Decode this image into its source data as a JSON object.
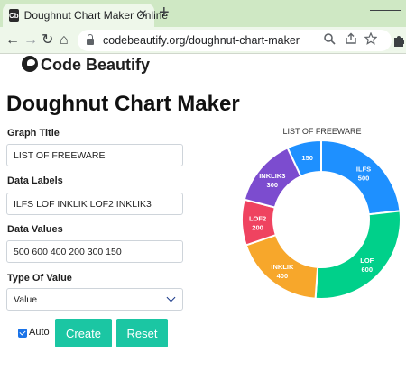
{
  "browser": {
    "tab_title": "Doughnut Chart Maker Online",
    "favicon_text": "Cb",
    "url": "codebeautify.org/doughnut-chart-maker",
    "new_tab": "+",
    "close": "×",
    "back": "←",
    "forward": "→",
    "reload": "↻",
    "home": "⌂"
  },
  "site": {
    "logo_text": "Code Beautify"
  },
  "page": {
    "title": "Doughnut Chart Maker",
    "graph_title_label": "Graph Title",
    "graph_title_value": "LIST OF FREEWARE",
    "data_labels_label": "Data Labels",
    "data_labels_value": "ILFS LOF INKLIK LOF2 INKLIK3",
    "data_values_label": "Data Values",
    "data_values_value": "500 600 400 200 300 150",
    "type_label": "Type Of Value",
    "type_value": "Value",
    "auto_label": "Auto",
    "create_label": "Create",
    "reset_label": "Reset"
  },
  "chart_data": {
    "type": "pie",
    "title": "LIST OF FREEWARE",
    "categories": [
      "ILFS",
      "LOF",
      "INKLIK",
      "LOF2",
      "INKLIK3",
      ""
    ],
    "values": [
      500,
      600,
      400,
      200,
      300,
      150
    ],
    "colors": [
      "#1e90ff",
      "#00d08a",
      "#f7a72b",
      "#ef4360",
      "#7c4ccf",
      "#1e90ff"
    ]
  }
}
